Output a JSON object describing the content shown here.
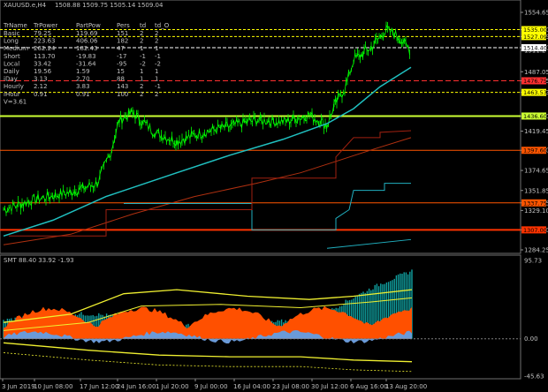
{
  "chart_header": {
    "symbol": "XAUUSD.e,H4",
    "ohlc": "1508.88 1509.75 1505.14 1509.04"
  },
  "stats_table": {
    "columns": [
      "TrName",
      "TrPower",
      "PartPow",
      "Pers",
      "td",
      "td_O"
    ],
    "rows": [
      [
        "Basic",
        "79.25",
        "119.69",
        "151",
        "2",
        "2"
      ],
      [
        "Long",
        "223.63",
        "406.06",
        "182",
        "2",
        "2"
      ],
      [
        "Medium",
        "262.24",
        "182.43",
        "47",
        "1",
        "1"
      ],
      [
        "Short",
        "113.70",
        "-19.83",
        "-17",
        "-1",
        "-1"
      ],
      [
        "Local",
        "33.42",
        "-31.64",
        "-95",
        "-2",
        "-2"
      ],
      [
        "Daily",
        "19.56",
        "1.59",
        "15",
        "1",
        "1"
      ],
      [
        "iDay",
        "3.13",
        "2.70",
        "88",
        "1",
        "1"
      ],
      [
        "Hourly",
        "2.12",
        "3.83",
        "143",
        "2",
        "-1"
      ],
      [
        "iHour",
        "0.91",
        "0.91",
        "100",
        "2",
        "2"
      ]
    ],
    "footer": "V=3.61"
  },
  "price_axis": [
    "1554.65",
    "1535.00",
    "1527.09",
    "1514.40",
    "1511.2",
    "1487.05",
    "1476.75",
    "1463.53",
    "1436.60",
    "1419.45",
    "1397.60",
    "1374.65",
    "1351.85",
    "1337.75",
    "1329.10",
    "1307.00",
    "1284.25"
  ],
  "level_tags": [
    {
      "label": "1535.00",
      "color": "#ffff00"
    },
    {
      "label": "1527.09",
      "color": "#ffff00"
    },
    {
      "label": "1514.40",
      "color": "#ffffff"
    },
    {
      "label": "1476.75",
      "color": "#ff3030"
    },
    {
      "label": "1463.53",
      "color": "#ffff00"
    },
    {
      "label": "1436.60",
      "color": "#ccff33"
    },
    {
      "label": "1397.60",
      "color": "#ff5500"
    },
    {
      "label": "1337.75",
      "color": "#ff5500"
    },
    {
      "label": "1307.00",
      "color": "#ff3300"
    }
  ],
  "indicator": {
    "label": "SMT 88.40 33.92 -1.93",
    "axis": [
      "95.73",
      "0.00",
      "-45.63"
    ]
  },
  "time_axis": [
    "3 Jun 2019",
    "10 Jun 08:00",
    "17 Jun 12:00",
    "24 Jun 16:00",
    "1 Jul 20:00",
    "9 Jul 00:00",
    "16 Jul 04:00",
    "23 Jul 08:00",
    "30 Jul 12:00",
    "6 Aug 16:00",
    "13 Aug 20:00"
  ],
  "colors": {
    "background": "#000000",
    "candles": "#00ff00",
    "ma_fast": "#20c0c0",
    "ma_slow": "#b03010",
    "histogram": "#10a0a0",
    "area_orange": "#ff5000",
    "area_blue": "#6a9ad8",
    "envelope": "#f0f030"
  }
}
